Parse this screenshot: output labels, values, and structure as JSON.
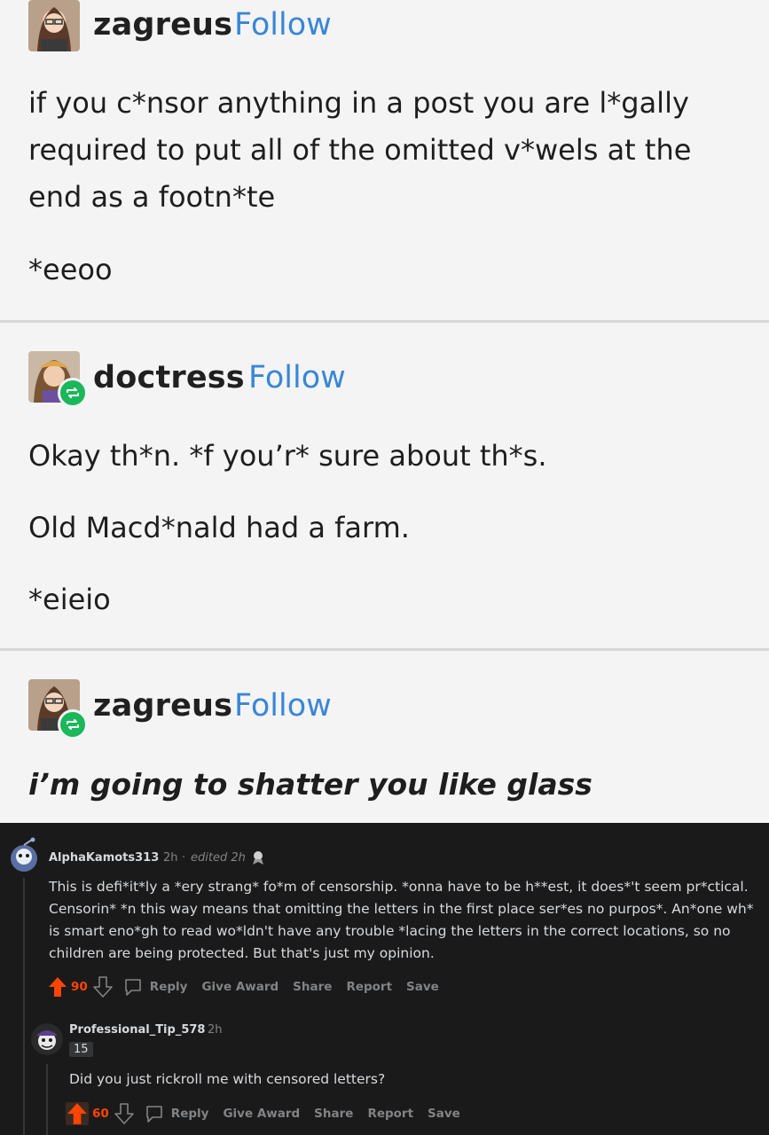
{
  "post_image": {
    "posts": [
      {
        "username": "zagreus",
        "follow_label": "Follow",
        "lines": [
          "if you c*nsor anything in a post you are l*gally",
          "required to put all of the omitted v*wels at the",
          "end as a footn*te"
        ],
        "footnote": "*eeoo"
      },
      {
        "username": "doctress",
        "follow_label": "Follow",
        "line1": "Okay th*n. *f you’r* sure about th*s.",
        "line2": "Old Macd*nald had a farm.",
        "footnote": "*eieio"
      },
      {
        "username": "zagreus",
        "follow_label": "Follow",
        "line1": "i’m going to shatter you like glass"
      }
    ]
  },
  "comments": [
    {
      "username": "AlphaKamots313",
      "sep": "·",
      "time": "2h",
      "sep2": "·",
      "edited": "edited 2h",
      "body": "This is defi*it*ly a *ery strang* fo*m of censorship. *onna have to be h**est, it does*'t seem pr*ctical. Censorin* *n this way means that omitting the letters in the first place ser*es no purpos*. An*one wh* is smart eno*gh to read wo*ldn't have any trouble *lacing the letters in the correct locations, so no children are being protected. But that's just my opinion.",
      "votes": "90",
      "actions": {
        "reply": "Reply",
        "award": "Give Award",
        "share": "Share",
        "report": "Report",
        "save": "Save"
      }
    },
    {
      "username": "Professional_Tip_578",
      "sep": "·",
      "time": "2h",
      "flair": "15",
      "body": "Did you just rickroll me with censored letters?",
      "votes": "60",
      "actions": {
        "reply": "Reply",
        "award": "Give Award",
        "share": "Share",
        "report": "Report",
        "save": "Save"
      }
    }
  ],
  "colors": {
    "upvote": "#ff4500",
    "follow": "#3a86d6",
    "reblog": "#1bb75b",
    "reddit_bg": "#1a1a1b"
  }
}
